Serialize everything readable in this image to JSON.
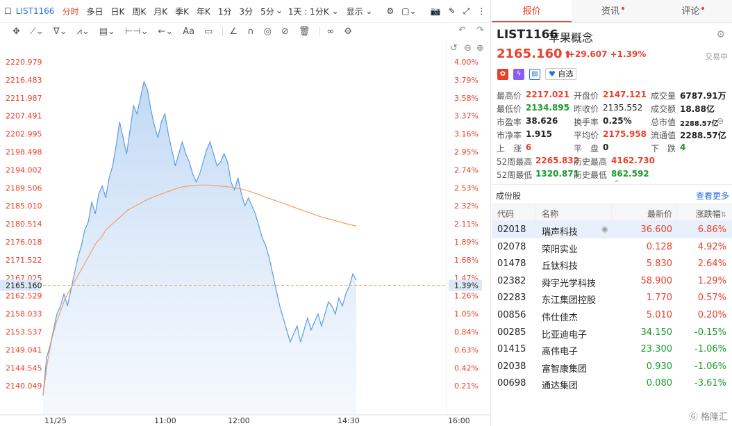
{
  "toolbar": {
    "symbol": "LIST1166",
    "periods": [
      "分时",
      "多日",
      "日K",
      "周K",
      "月K",
      "季K",
      "年K",
      "1分",
      "3分",
      "5分"
    ],
    "active_period": "分时",
    "range": "1天 : 1分K",
    "display": "显示"
  },
  "chart": {
    "y_labels": [
      "2220.979",
      "2216.483",
      "2211.987",
      "2207.491",
      "2202.995",
      "2198.498",
      "2194.002",
      "2189.506",
      "2185.010",
      "2180.514",
      "2176.018",
      "2171.522",
      "2167.025",
      "2162.529",
      "2158.033",
      "2153.537",
      "2149.041",
      "2144.545",
      "2140.049"
    ],
    "pct_labels": [
      "4.00%",
      "3.79%",
      "3.58%",
      "3.37%",
      "3.16%",
      "2.95%",
      "2.74%",
      "2.53%",
      "2.32%",
      "2.11%",
      "1.89%",
      "1.68%",
      "1.47%",
      "1.26%",
      "1.05%",
      "0.84%",
      "0.63%",
      "0.42%",
      "0.21%"
    ],
    "current_price": "2165.160",
    "current_pct": "1.39%",
    "x_labels": [
      "11/25",
      "11:00",
      "12:00",
      "14:30",
      "16:00"
    ]
  },
  "chart_data": {
    "type": "line",
    "ylim": [
      2135.553,
      2221.0
    ],
    "series": [
      {
        "name": "price",
        "values": [
          2137.6,
          2147,
          2150,
          2154,
          2158,
          2160,
          2163,
          2160,
          2164,
          2168,
          2172,
          2175,
          2179,
          2181,
          2186,
          2183,
          2188,
          2190,
          2187,
          2192,
          2195,
          2200,
          2206,
          2202,
          2198,
          2204,
          2210,
          2208,
          2212,
          2216,
          2214,
          2209,
          2205,
          2202,
          2206,
          2208,
          2203,
          2199,
          2195,
          2198,
          2201,
          2198,
          2196,
          2193,
          2191,
          2193,
          2196,
          2199,
          2201,
          2198,
          2195,
          2196,
          2198,
          2196,
          2191,
          2189,
          2192,
          2188,
          2185,
          2187,
          2185,
          2183,
          2180,
          2177,
          2175,
          2172,
          2168,
          2164,
          2160,
          2157,
          2154,
          2151,
          2153,
          2155,
          2151,
          2154,
          2157,
          2154,
          2156,
          2158,
          2155,
          2158,
          2161,
          2160,
          2158,
          2162,
          2160,
          2163,
          2165,
          2168,
          2166.5
        ]
      },
      {
        "name": "avg",
        "values": [
          2137.6,
          2146,
          2152,
          2156,
          2159,
          2162,
          2164,
          2166,
          2168,
          2170,
          2172,
          2174,
          2176,
          2177,
          2179,
          2180,
          2181,
          2182,
          2183,
          2184,
          2184.6,
          2185.2,
          2185.8,
          2186.4,
          2186.9,
          2187.4,
          2187.8,
          2188.2,
          2188.6,
          2189,
          2189.4,
          2189.7,
          2189.9,
          2190,
          2190.1,
          2190.2,
          2190.2,
          2190.2,
          2190.1,
          2190.0,
          2189.9,
          2189.8,
          2189.7,
          2189.5,
          2189.3,
          2189.0,
          2188.7,
          2188.3,
          2187.9,
          2187.5,
          2187.1,
          2186.7,
          2186.3,
          2185.9,
          2185.5,
          2185.1,
          2184.7,
          2184.3,
          2183.9,
          2183.5,
          2183.1,
          2182.7,
          2182.3,
          2182.0,
          2181.7,
          2181.4,
          2181.1,
          2180.8,
          2180.5,
          2180.2,
          2180.0
        ]
      }
    ]
  },
  "quote": {
    "symbol": "LIST1166",
    "name": "苹果概念",
    "price": "2165.160",
    "arrow": "⬆",
    "change": "+29.607",
    "change_pct": "+1.39%",
    "status": "交易中",
    "watch_label": "自选"
  },
  "tabs": [
    "报价",
    "资讯",
    "评论"
  ],
  "stats": {
    "high_l": "最高价",
    "high": "2217.021",
    "open_l": "开盘价",
    "open": "2147.121",
    "vol_l": "成交量",
    "vol": "6787.91万",
    "low_l": "最低价",
    "low": "2134.895",
    "prev_l": "昨收价",
    "prev": "2135.552",
    "amt_l": "成交额",
    "amt": "18.88亿",
    "pe_l": "市盈率",
    "pe": "38.626",
    "turn_l": "换手率",
    "turn": "0.25%",
    "mcap_l": "总市值",
    "mcap": "2288.57亿",
    "pb_l": "市净率",
    "pb": "1.915",
    "avg_l": "平均价",
    "avg": "2175.958",
    "float_l": "流通值",
    "float": "2288.57亿",
    "up_l": "上　涨",
    "up": "6",
    "flat_l": "平　盘",
    "flat": "0",
    "down_l": "下　跌",
    "down": "4",
    "h52_l": "52周最高",
    "h52": "2265.832",
    "hh_l": "历史最高",
    "hh": "4162.730",
    "l52_l": "52周最低",
    "l52": "1320.871",
    "hl_l": "历史最低",
    "hl": "862.592"
  },
  "constituents": {
    "title": "成份股",
    "more": "查看更多",
    "headers": [
      "代码",
      "名称",
      "最新价",
      "涨跌幅"
    ],
    "rows": [
      {
        "code": "02018",
        "name": "瑞声科技",
        "price": "36.600",
        "pct": "6.86%",
        "up": true
      },
      {
        "code": "02078",
        "name": "荣阳实业",
        "price": "0.128",
        "pct": "4.92%",
        "up": true
      },
      {
        "code": "01478",
        "name": "丘钛科技",
        "price": "5.830",
        "pct": "2.64%",
        "up": true
      },
      {
        "code": "02382",
        "name": "舜宇光学科技",
        "price": "58.900",
        "pct": "1.29%",
        "up": true
      },
      {
        "code": "02283",
        "name": "东江集团控股",
        "price": "1.770",
        "pct": "0.57%",
        "up": true
      },
      {
        "code": "00856",
        "name": "伟仕佳杰",
        "price": "5.010",
        "pct": "0.20%",
        "up": true
      },
      {
        "code": "00285",
        "name": "比亚迪电子",
        "price": "34.150",
        "pct": "-0.15%",
        "up": false
      },
      {
        "code": "01415",
        "name": "高伟电子",
        "price": "23.300",
        "pct": "-1.06%",
        "up": false
      },
      {
        "code": "02038",
        "name": "富智康集团",
        "price": "0.930",
        "pct": "-1.06%",
        "up": false
      },
      {
        "code": "00698",
        "name": "通达集团",
        "price": "0.080",
        "pct": "-3.61%",
        "up": false
      }
    ]
  },
  "watermark": "格隆汇"
}
